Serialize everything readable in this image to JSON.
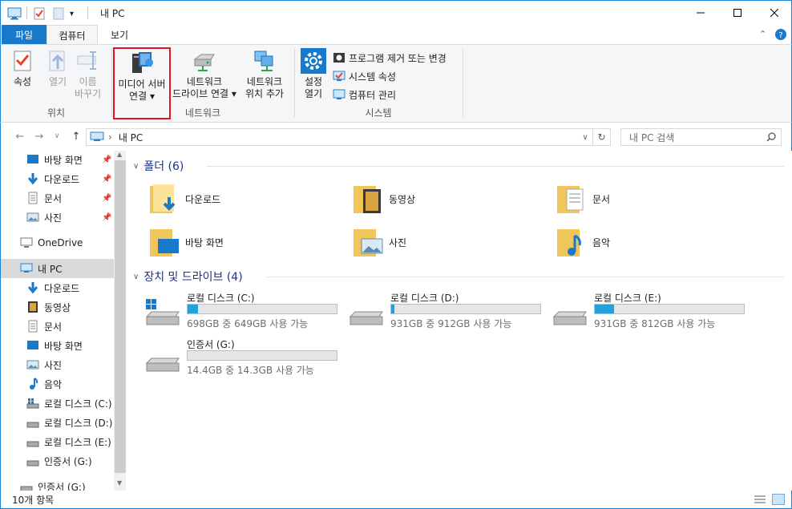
{
  "window": {
    "title": "내 PC"
  },
  "tabs": {
    "file": "파일",
    "computer": "컴퓨터",
    "view": "보기"
  },
  "ribbon": {
    "location": {
      "properties": "속성",
      "open": "열기",
      "rename_1": "이름",
      "rename_2": "바꾸기",
      "label": "위치"
    },
    "network": {
      "media_1": "미디어 서버",
      "media_2": "연결",
      "map_1": "네트워크",
      "map_2": "드라이브 연결",
      "add_1": "네트워크",
      "add_2": "위치 추가",
      "label": "네트워크"
    },
    "system": {
      "settings_1": "설정",
      "settings_2": "열기",
      "uninstall": "프로그램 제거 또는 변경",
      "sysprops": "시스템 속성",
      "manage": "컴퓨터 관리",
      "label": "시스템"
    }
  },
  "address": {
    "path": "내 PC",
    "search_placeholder": "내 PC 검색"
  },
  "sidebar": {
    "quick": [
      "바탕 화면",
      "다운로드",
      "문서",
      "사진"
    ],
    "onedrive": "OneDrive",
    "thispc": "내 PC",
    "pc_items": [
      "다운로드",
      "동영상",
      "문서",
      "바탕 화면",
      "사진",
      "음악",
      "로컬 디스크 (C:)",
      "로컬 디스크 (D:)",
      "로컬 디스크 (E:)",
      "인증서 (G:)"
    ],
    "extra": "인증서 (G:)"
  },
  "content": {
    "folders_header": "폴더 (6)",
    "folders": [
      "다운로드",
      "동영상",
      "문서",
      "바탕 화면",
      "사진",
      "음악"
    ],
    "drives_header": "장치 및 드라이브 (4)",
    "drives": [
      {
        "name": "로컬 디스크 (C:)",
        "free": "698GB 중 649GB 사용 가능",
        "used_fraction": 0.07
      },
      {
        "name": "로컬 디스크 (D:)",
        "free": "931GB 중 912GB 사용 가능",
        "used_fraction": 0.02
      },
      {
        "name": "로컬 디스크 (E:)",
        "free": "931GB 중 812GB 사용 가능",
        "used_fraction": 0.13
      },
      {
        "name": "인증서 (G:)",
        "free": "14.4GB 중 14.3GB 사용 가능",
        "used_fraction": 0.0
      }
    ]
  },
  "status": {
    "count": "10개 항목"
  },
  "colors": {
    "accent": "#1979ca",
    "selected": "#d9d9d9",
    "highlight_box": "#e81123"
  }
}
